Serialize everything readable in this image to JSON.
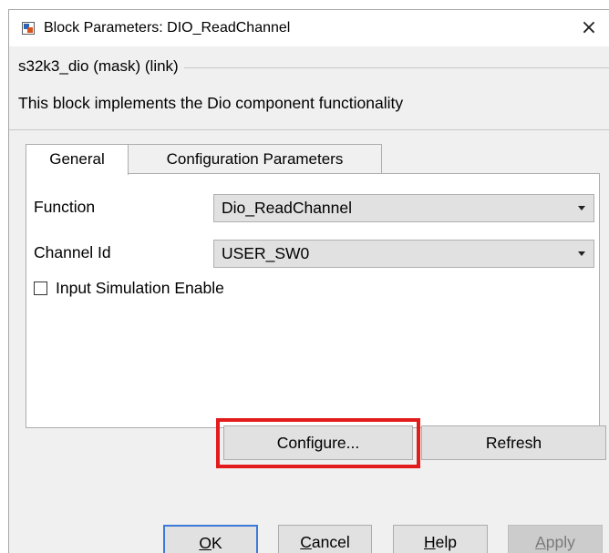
{
  "window": {
    "title": "Block Parameters: DIO_ReadChannel",
    "close_glyph": "×"
  },
  "mask": {
    "group_title": "s32k3_dio (mask) (link)",
    "description": "This block implements the Dio component functionality"
  },
  "tabs": [
    {
      "label": "General",
      "selected": true
    },
    {
      "label": "Configuration Parameters",
      "selected": false
    }
  ],
  "general": {
    "function": {
      "label": "Function",
      "value": "Dio_ReadChannel"
    },
    "channel_id": {
      "label": "Channel Id",
      "value": "USER_SW0"
    },
    "input_sim": {
      "label": "Input Simulation Enable",
      "checked": false
    }
  },
  "actions": {
    "configure": "Configure...",
    "refresh": "Refresh"
  },
  "footer": {
    "ok_mnemonic": "O",
    "ok_rest": "K",
    "cancel_mnemonic": "C",
    "cancel_rest": "ancel",
    "help_mnemonic": "H",
    "help_rest": "elp",
    "apply_mnemonic": "A",
    "apply_rest": "pply"
  },
  "colors": {
    "highlight": "#e21b1b",
    "default_button_border": "#3b7ad9"
  }
}
